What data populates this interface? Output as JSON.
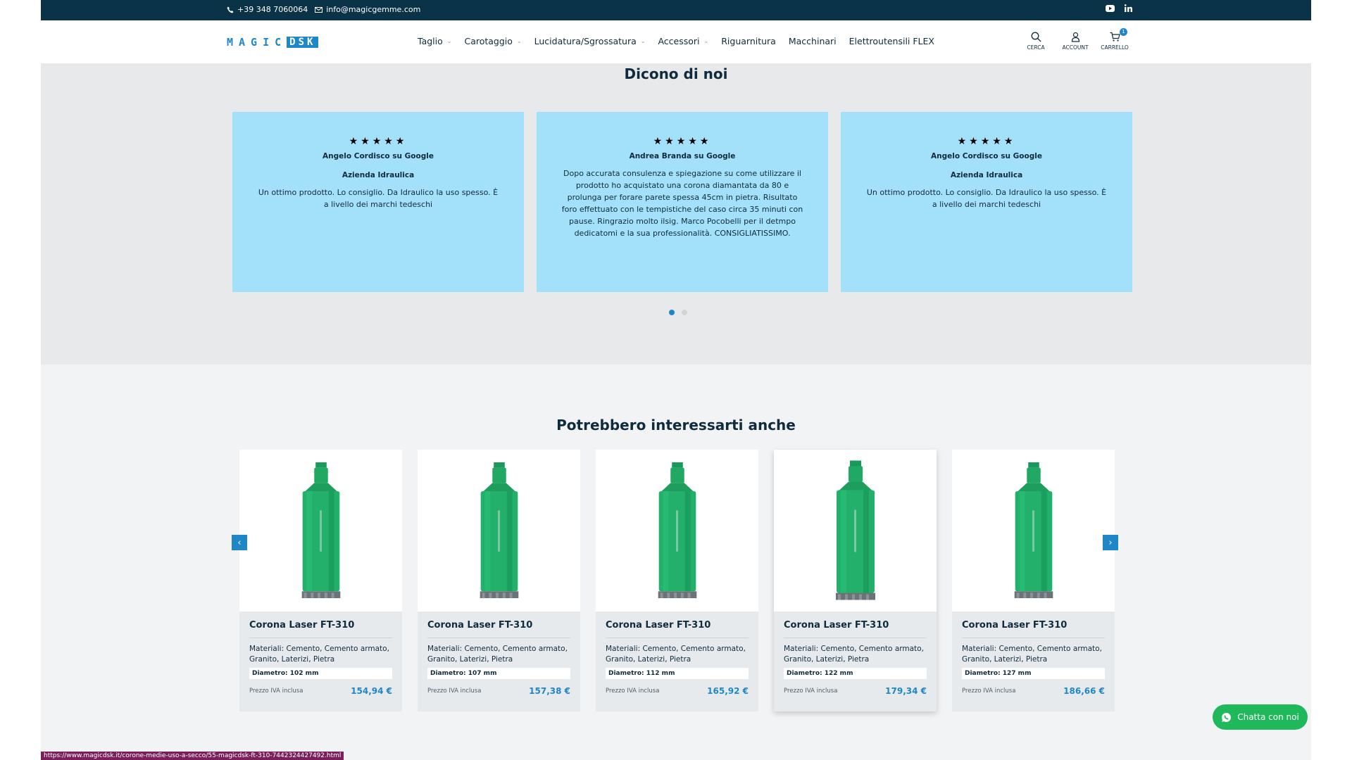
{
  "topbar": {
    "phone": "+39 348 7060064",
    "email": "info@magicgemme.com",
    "social": [
      "youtube-icon",
      "linkedin-icon"
    ]
  },
  "header": {
    "logo_part1": "MAGIC",
    "logo_part2": "DSK",
    "nav": [
      {
        "label": "Taglio",
        "has_dropdown": true
      },
      {
        "label": "Carotaggio",
        "has_dropdown": true
      },
      {
        "label": "Lucidatura/Sgrossatura",
        "has_dropdown": true
      },
      {
        "label": "Accessori",
        "has_dropdown": true
      },
      {
        "label": "Riguarnitura",
        "has_dropdown": false
      },
      {
        "label": "Macchinari",
        "has_dropdown": false
      },
      {
        "label": "Elettroutensili FLEX",
        "has_dropdown": false
      }
    ],
    "search_label": "CERCA",
    "account_label": "ACCOUNT",
    "cart_label": "CARRELLO",
    "cart_count": "1"
  },
  "reviews": {
    "title": "Dicono di noi",
    "items": [
      {
        "stars": "★★★★★",
        "name": "Angelo Cordisco su Google",
        "company": "Azienda Idraulica",
        "text": "Un ottimo prodotto. Lo consiglio. Da Idraulico la uso spesso. È a livello dei marchi tedeschi"
      },
      {
        "stars": "★★★★★",
        "name": "Andrea Branda su Google",
        "company": "",
        "text": "Dopo accurata consulenza e spiegazione su come utilizzare il prodotto ho acquistato una corona diamantata da 80 e prolunga per forare parete spessa 45cm in pietra. Risultato foro effettuato con le tempistiche del caso circa 35 minuti con pause. Ringrazio molto ilsig. Marco Pocobelli per il detmpo dedicatomi e la sua professionalità. CONSIGLIATISSIMO."
      },
      {
        "stars": "★★★★★",
        "name": "Angelo Cordisco su Google",
        "company": "Azienda Idraulica",
        "text": "Un ottimo prodotto. Lo consiglio. Da Idraulico la uso spesso. È a livello dei marchi tedeschi"
      }
    ],
    "active_dot": 0,
    "dot_count": 2
  },
  "products": {
    "title": "Potrebbero interessarti anche",
    "items": [
      {
        "name": "Corona Laser FT-310",
        "materials": "Materiali: Cemento, Cemento armato, Granito, Laterizi, Pietra",
        "diameter": "Diametro: 102 mm",
        "vat": "Prezzo IVA inclusa",
        "price": "154,94 €"
      },
      {
        "name": "Corona Laser FT-310",
        "materials": "Materiali: Cemento, Cemento armato, Granito, Laterizi, Pietra",
        "diameter": "Diametro: 107 mm",
        "vat": "Prezzo IVA inclusa",
        "price": "157,38 €"
      },
      {
        "name": "Corona Laser FT-310",
        "materials": "Materiali: Cemento, Cemento armato, Granito, Laterizi, Pietra",
        "diameter": "Diametro: 112 mm",
        "vat": "Prezzo IVA inclusa",
        "price": "165,92 €"
      },
      {
        "name": "Corona Laser FT-310",
        "materials": "Materiali: Cemento, Cemento armato, Granito, Laterizi, Pietra",
        "diameter": "Diametro: 122 mm",
        "vat": "Prezzo IVA inclusa",
        "price": "179,34 €"
      },
      {
        "name": "Corona Laser FT-310",
        "materials": "Materiali: Cemento, Cemento armato, Granito, Laterizi, Pietra",
        "diameter": "Diametro: 127 mm",
        "vat": "Prezzo IVA inclusa",
        "price": "186,66 €"
      }
    ],
    "prev_icon": "chevron-left-icon",
    "next_icon": "chevron-right-icon"
  },
  "chat": {
    "label": "Chatta con noi"
  },
  "status_bar": {
    "url": "https://www.magicdsk.it/corone-medie-uso-a-secco/55-magicdsk-ft-310-7442324427492.html"
  },
  "colors": {
    "topbar": "#0b3347",
    "accent": "#1f86c8",
    "review_card": "#a2e1f9",
    "whatsapp": "#1fb85a"
  }
}
